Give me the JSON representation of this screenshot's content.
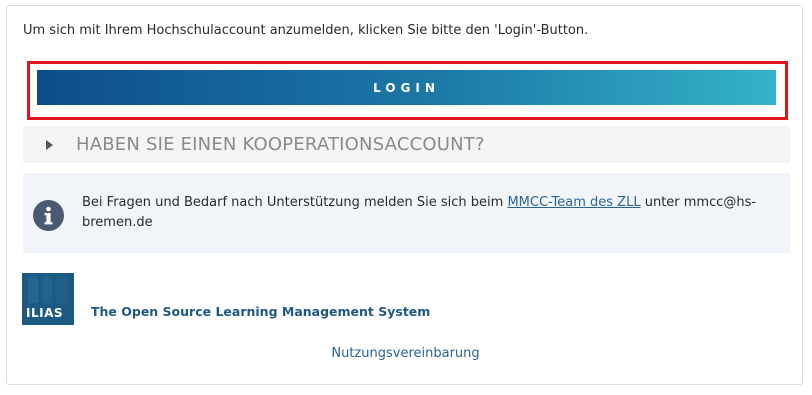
{
  "intro": {
    "text": "Um sich mit Ihrem Hochschulaccount anzumelden, klicken Sie bitte den 'Login'-Button."
  },
  "login": {
    "label": "LOGIN"
  },
  "cooperation": {
    "title": "HABEN SIE EINEN KOOPERATIONSACCOUNT?",
    "icon": "triangle-right-icon"
  },
  "info": {
    "icon": "info-icon",
    "text_before": "Bei Fragen und Bedarf nach Unterstützung melden Sie sich beim ",
    "link_text": "MMCC-Team des ZLL",
    "text_after": " unter mmcc@hs-bremen.de"
  },
  "branding": {
    "logo_text": "ILIAS",
    "tagline": "The Open Source Learning Management System"
  },
  "footer": {
    "link": "Nutzungsvereinbarung"
  },
  "colors": {
    "highlight": "#e2141e",
    "brand": "#1d5a83",
    "link": "#2a6599"
  }
}
